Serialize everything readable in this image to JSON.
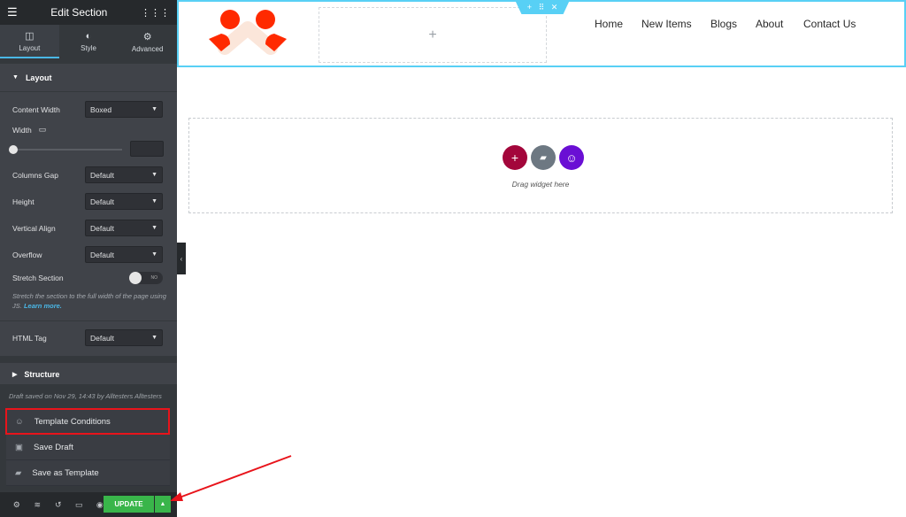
{
  "panel": {
    "title": "Edit Section",
    "tabs": [
      {
        "label": "Layout",
        "icon": "columns-icon"
      },
      {
        "label": "Style",
        "icon": "half-circle-icon"
      },
      {
        "label": "Advanced",
        "icon": "gear-icon"
      }
    ],
    "layout_section": "Layout",
    "fields": {
      "content_width": {
        "label": "Content Width",
        "value": "Boxed"
      },
      "width": {
        "label": "Width",
        "value": ""
      },
      "columns_gap": {
        "label": "Columns Gap",
        "value": "Default"
      },
      "height": {
        "label": "Height",
        "value": "Default"
      },
      "vertical_align": {
        "label": "Vertical Align",
        "value": "Default"
      },
      "overflow": {
        "label": "Overflow",
        "value": "Default"
      },
      "stretch": {
        "label": "Stretch Section",
        "toggle": "NO",
        "desc": "Stretch the section to the full width of the page using JS.",
        "link": "Learn more."
      },
      "html_tag": {
        "label": "HTML Tag",
        "value": "Default"
      }
    },
    "structure_section": "Structure",
    "draft_status": "Draft saved on Nov 29, 14:43 by Alltesters Alltesters",
    "menu": [
      "Template Conditions",
      "Save Draft",
      "Save as Template"
    ],
    "update_label": "UPDATE"
  },
  "canvas": {
    "nav": [
      "Home",
      "New Items",
      "Blogs",
      "About",
      "Contact Us"
    ],
    "drag_text": "Drag widget here"
  },
  "colors": {
    "accent": "#4ab7e6",
    "update": "#39b54a",
    "annotation": "#e8141b",
    "logo": "#ff2a00"
  }
}
